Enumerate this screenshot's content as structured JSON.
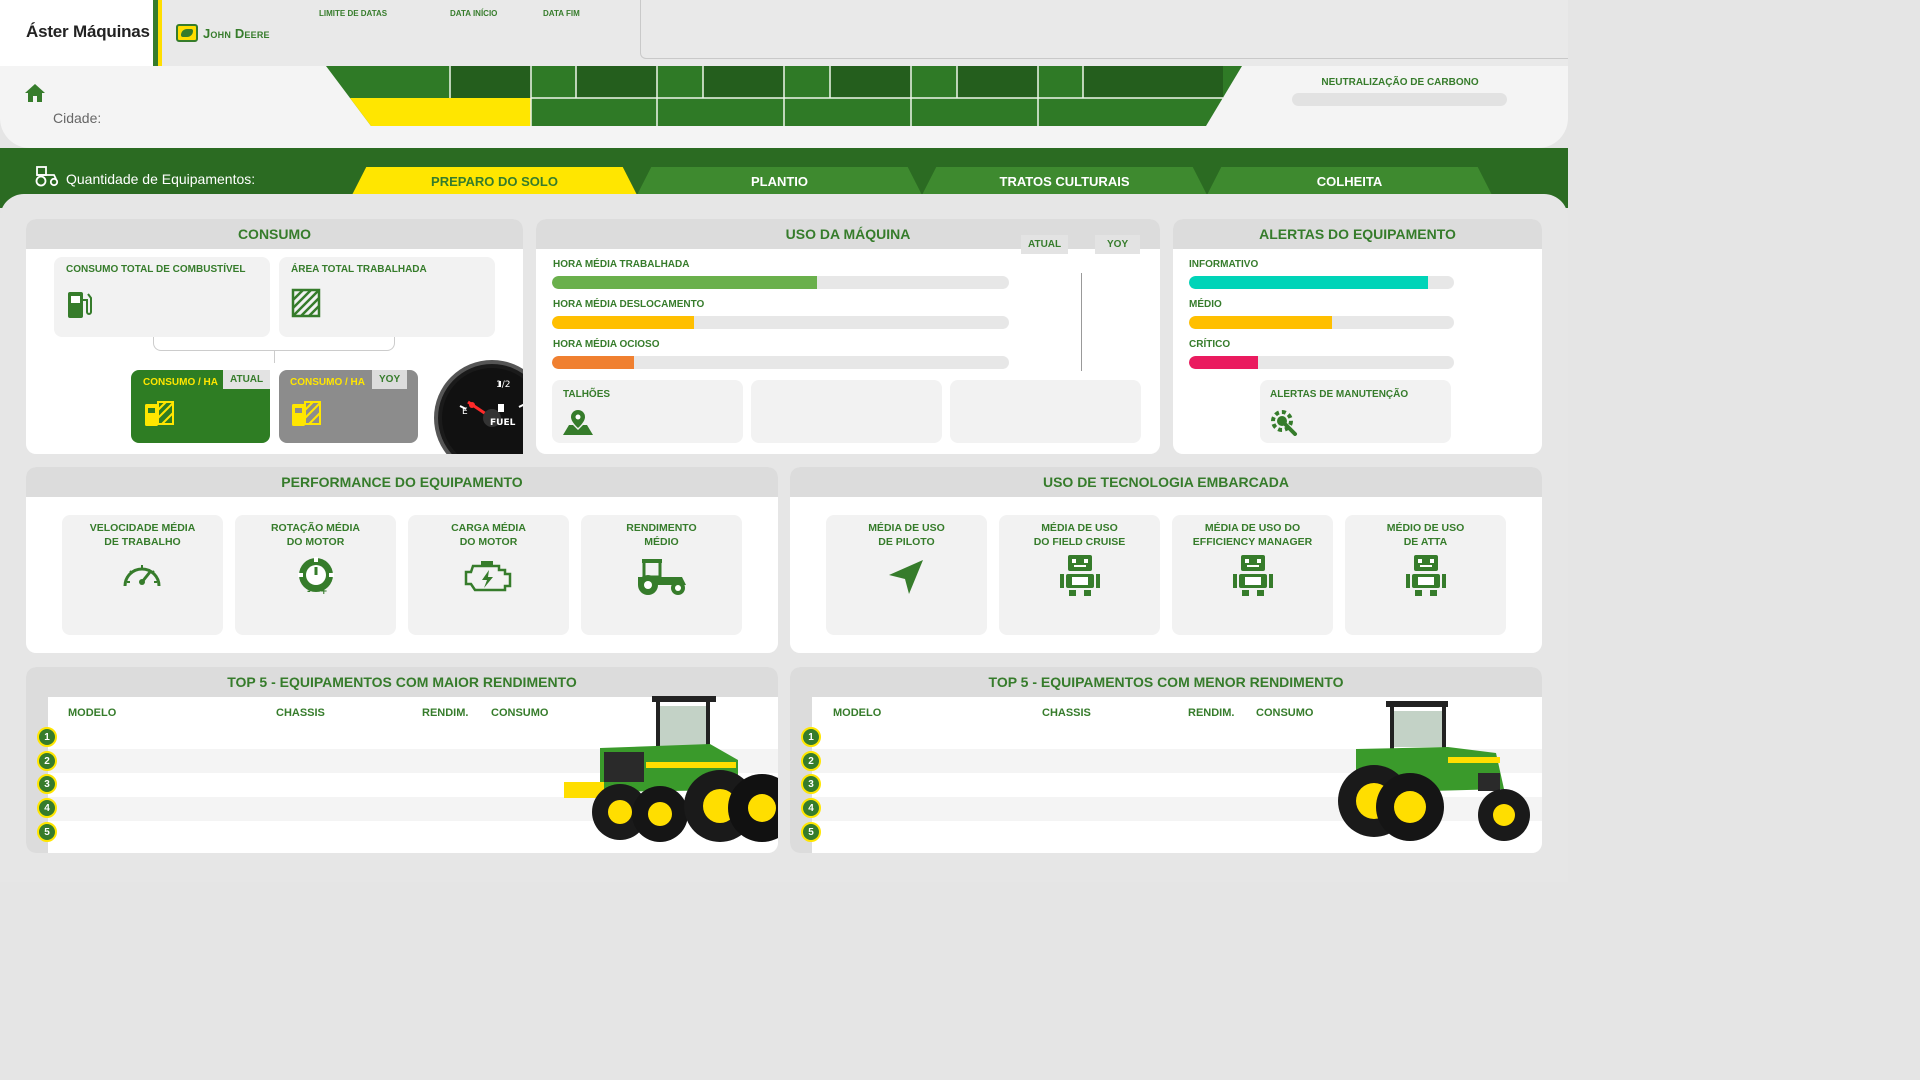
{
  "app": {
    "title": "Áster Máquinas",
    "brand": "John Deere"
  },
  "filters": {
    "limit_label": "LIMITE DE DATAS",
    "start_label": "DATA INÍCIO",
    "end_label": "DATA FIM"
  },
  "header": {
    "city_label": "Cidade:",
    "carbon_label": "NEUTRALIZAÇÃO DE CARBONO"
  },
  "equipment": {
    "qty_label": "Quantidade de Equipamentos:"
  },
  "tabs": [
    {
      "label": "PREPARO DO SOLO",
      "active": true
    },
    {
      "label": "PLANTIO",
      "active": false
    },
    {
      "label": "TRATOS CULTURAIS",
      "active": false
    },
    {
      "label": "COLHEITA",
      "active": false
    }
  ],
  "consumo": {
    "title": "CONSUMO",
    "fuel_label": "CONSUMO TOTAL DE COMBUSTÍVEL",
    "area_label": "ÁREA TOTAL TRABALHADA",
    "atual_box": {
      "label": "CONSUMO / HA",
      "tag": "ATUAL"
    },
    "yoy_box": {
      "label": "CONSUMO / HA",
      "tag": "YOY"
    },
    "gauge": {
      "half": "1/2",
      "empty": "E",
      "fuel": "FUEL"
    }
  },
  "uso_maquina": {
    "title": "USO DA MÁQUINA",
    "atual_tag": "ATUAL",
    "yoy_tag": "YOY",
    "bars": [
      {
        "label": "HORA MÉDIA TRABALHADA",
        "fraction": 0.58,
        "color": "#6ab04c"
      },
      {
        "label": "HORA MÉDIA DESLOCAMENTO",
        "fraction": 0.31,
        "color": "#ffbf00"
      },
      {
        "label": "HORA MÉDIA OCIOSO",
        "fraction": 0.18,
        "color": "#f08030"
      }
    ],
    "talhoes_label": "TALHÕES"
  },
  "alertas": {
    "title": "ALERTAS DO EQUIPAMENTO",
    "bars": [
      {
        "label": "INFORMATIVO",
        "fraction": 0.9,
        "color": "#00d4b8"
      },
      {
        "label": "MÉDIO",
        "fraction": 0.54,
        "color": "#ffbf00"
      },
      {
        "label": "CRÍTICO",
        "fraction": 0.26,
        "color": "#ea1b5f"
      }
    ],
    "manutencao_label": "ALERTAS DE MANUTENÇÃO"
  },
  "performance": {
    "title": "PERFORMANCE DO EQUIPAMENTO",
    "items": [
      {
        "line1": "VELOCIDADE MÉDIA",
        "line2": "DE TRABALHO",
        "icon": "speedometer-icon"
      },
      {
        "line1": "ROTAÇÃO MÉDIA",
        "line2": "DO MOTOR",
        "icon": "engine-rpm-icon"
      },
      {
        "line1": "CARGA MÉDIA",
        "line2": "DO MOTOR",
        "icon": "engine-load-icon"
      },
      {
        "line1": "RENDIMENTO",
        "line2": "MÉDIO",
        "icon": "tractor-icon"
      }
    ]
  },
  "tecnologia": {
    "title": "USO DE TECNOLOGIA EMBARCADA",
    "items": [
      {
        "line1": "MÉDIA DE USO",
        "line2": "DE PILOTO",
        "icon": "navigation-icon"
      },
      {
        "line1": "MÉDIA DE USO",
        "line2": "DO FIELD CRUISE",
        "icon": "robot-icon"
      },
      {
        "line1": "MÉDIA DE USO DO",
        "line2": "EFFICIENCY MANAGER",
        "icon": "robot-icon"
      },
      {
        "line1": "MÉDIO DE USO",
        "line2": "DE ATTA",
        "icon": "robot-icon"
      }
    ]
  },
  "top5_maior": {
    "title": "TOP 5 - EQUIPAMENTOS COM MAIOR RENDIMENTO",
    "columns": [
      "MODELO",
      "CHASSIS",
      "RENDIM.",
      "CONSUMO"
    ],
    "ranks": [
      "1",
      "2",
      "3",
      "4",
      "5"
    ]
  },
  "top5_menor": {
    "title": "TOP 5 - EQUIPAMENTOS COM MENOR RENDIMENTO",
    "columns": [
      "MODELO",
      "CHASSIS",
      "RENDIM.",
      "CONSUMO"
    ],
    "ranks": [
      "1",
      "2",
      "3",
      "4",
      "5"
    ]
  },
  "colors": {
    "brand_green": "#367c2b",
    "dark_green": "#2b6b22",
    "brand_yellow": "#ffe600"
  }
}
